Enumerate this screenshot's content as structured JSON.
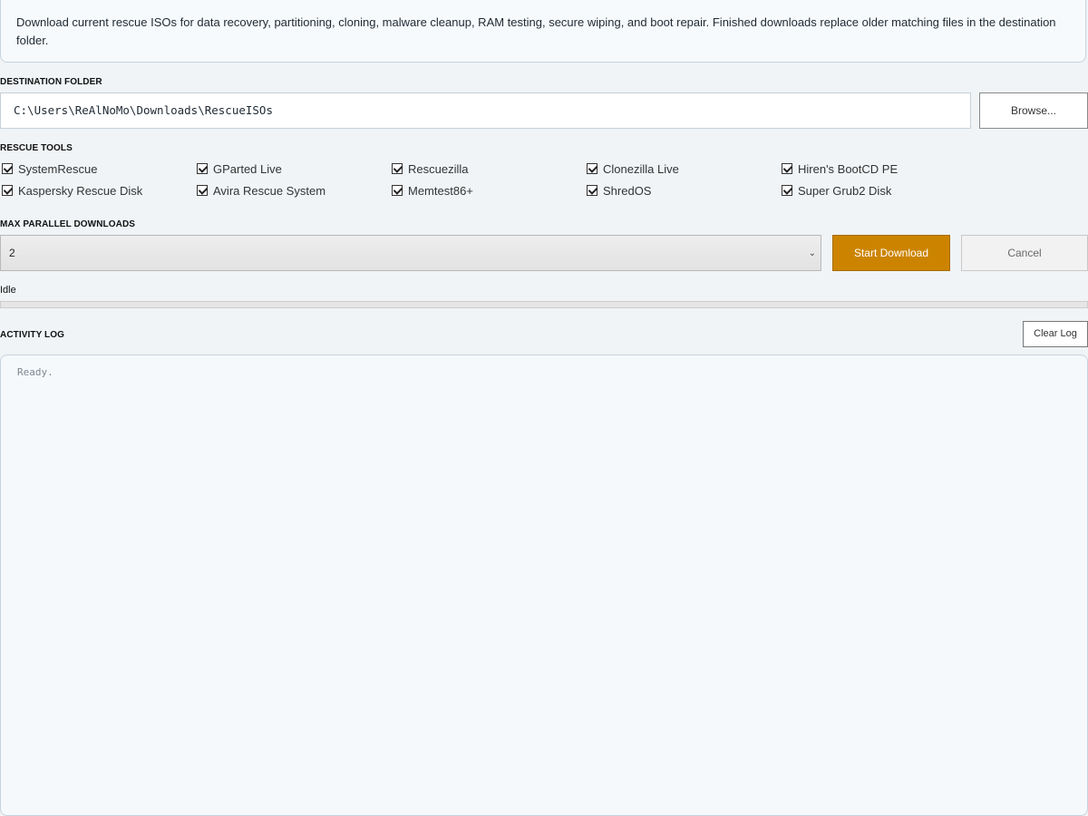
{
  "info": {
    "description": "Download current rescue ISOs for data recovery, partitioning, cloning, malware cleanup, RAM testing, secure wiping, and boot repair. Finished downloads replace older matching files in the destination folder."
  },
  "destination": {
    "label": "DESTINATION FOLDER",
    "path": "C:\\Users\\ReAlNoMo\\Downloads\\RescueISOs",
    "browse_label": "Browse..."
  },
  "tools": {
    "label": "RESCUE TOOLS",
    "items": [
      {
        "label": "SystemRescue",
        "checked": true
      },
      {
        "label": "GParted Live",
        "checked": true
      },
      {
        "label": "Rescuezilla",
        "checked": true
      },
      {
        "label": "Clonezilla Live",
        "checked": true
      },
      {
        "label": "Hiren's BootCD PE",
        "checked": true
      },
      {
        "label": "Kaspersky Rescue Disk",
        "checked": true
      },
      {
        "label": "Avira Rescue System",
        "checked": true
      },
      {
        "label": "Memtest86+",
        "checked": true
      },
      {
        "label": "ShredOS",
        "checked": true
      },
      {
        "label": "Super Grub2 Disk",
        "checked": true
      }
    ]
  },
  "parallel": {
    "label": "MAX PARALLEL DOWNLOADS",
    "selected": "2"
  },
  "actions": {
    "start_label": "Start Download",
    "cancel_label": "Cancel"
  },
  "status": {
    "text": "Idle",
    "progress": 0
  },
  "log": {
    "label": "ACTIVITY LOG",
    "clear_label": "Clear Log",
    "text": "Ready."
  },
  "colors": {
    "accent": "#cc8400",
    "background": "#f0f4f7"
  }
}
